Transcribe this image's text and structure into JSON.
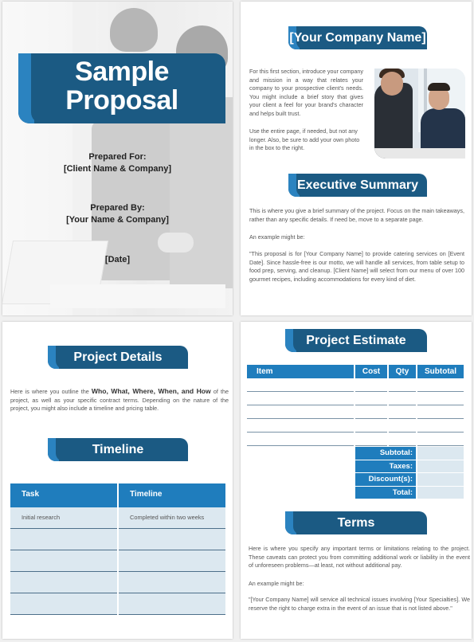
{
  "theme": {
    "banner_dark": "#1b5a83",
    "banner_light": "#2b83c0",
    "table_header": "#1f7dbd",
    "table_row": "#dce8f0"
  },
  "cover": {
    "title_line1": "Sample",
    "title_line2": "Proposal",
    "prepared_for_label": "Prepared For:",
    "prepared_for_value": "[Client Name & Company]",
    "prepared_by_label": "Prepared By:",
    "prepared_by_value": "[Your Name & Company]",
    "date": "[Date]"
  },
  "intro": {
    "heading": "[Your Company Name]",
    "paragraph1": "For this first section, introduce your company and mission in a way that relates your company to your prospective client's needs. You might include a brief story that gives your client a feel for your brand's character and helps built trust.",
    "paragraph2": "Use the entire page, if needed, but not any longer. Also, be sure to add your own photo in the box to the right."
  },
  "executive_summary": {
    "heading": "Executive Summary",
    "paragraph1": "This is where you give a brief summary of the project. Focus on the main takeaways, rather than any specific details. If need be, move to a separate page.",
    "paragraph2": "An example might be:",
    "paragraph3": "\"This proposal is for [Your Company Name] to provide catering services on [Event Date]. Since hassle-free is our motto, we will handle all services, from table setup to food prep, serving, and cleanup. [Client Name] will select from our menu of over 100 gourmet recipes, including accommodations for every kind of diet."
  },
  "project_details": {
    "heading": "Project Details",
    "text_before": "Here is where you outline the ",
    "text_bold": "Who, What, Where, When, and How",
    "text_after": " of the project, as well as your specific contract terms. Depending on the nature of the project, you might also include a timeline and pricing table."
  },
  "timeline": {
    "heading": "Timeline",
    "columns": [
      "Task",
      "Timeline"
    ],
    "rows": [
      [
        "Initial research",
        "Completed within two weeks"
      ],
      [
        "",
        ""
      ],
      [
        "",
        ""
      ],
      [
        "",
        ""
      ],
      [
        "",
        ""
      ]
    ]
  },
  "estimate": {
    "heading": "Project Estimate",
    "columns": [
      "Item",
      "Cost",
      "Qty",
      "Subtotal"
    ],
    "blank_rows": 5,
    "summary_labels": [
      "Subtotal:",
      "Taxes:",
      "Discount(s):",
      "Total:"
    ]
  },
  "terms": {
    "heading": "Terms",
    "paragraph1": "Here is where you specify any important terms or limitations relating to the project. These caveats can protect you from committing additional work or liability in the event of unforeseen problems—at least, not without additional pay.",
    "paragraph2": "An example might be:",
    "paragraph3": "\"[Your Company Name] will service all technical issues involving [Your Specialties]. We reserve the right to charge extra in the event of an issue that is not listed above.\""
  }
}
